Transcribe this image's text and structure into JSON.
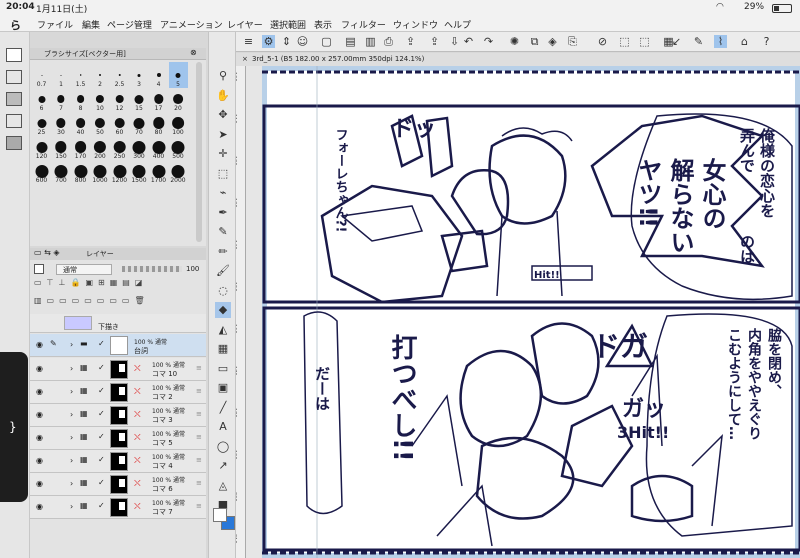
{
  "status": {
    "time": "20:04",
    "date": "1月11日(土)",
    "battery": "29%"
  },
  "menu": [
    "ファイル",
    "編集",
    "ページ管理",
    "アニメーション",
    "レイヤー",
    "選択範囲",
    "表示",
    "フィルター",
    "ウィンドウ",
    "ヘルプ"
  ],
  "brush_panel": {
    "title": "ブラシサイズ[ベクター用]",
    "sizes": [
      "0.7",
      "1",
      "1.5",
      "2",
      "2.5",
      "3",
      "4",
      "5",
      "6",
      "7",
      "8",
      "10",
      "12",
      "15",
      "17",
      "20",
      "25",
      "30",
      "40",
      "50",
      "60",
      "70",
      "80",
      "100",
      "120",
      "150",
      "170",
      "200",
      "250",
      "300",
      "400",
      "500",
      "600",
      "700",
      "800",
      "1000",
      "1200",
      "1500",
      "1700",
      "2000"
    ],
    "selected": "5"
  },
  "layer_panel": {
    "title": "レイヤー",
    "blend_mode": "通常",
    "opacity": "100",
    "top_partial": "下描き",
    "folder": {
      "info": "100 % 通常",
      "name": "台詞"
    },
    "layers": [
      {
        "info": "100 % 通常",
        "name": "コマ 10"
      },
      {
        "info": "100 % 通常",
        "name": "コマ 2"
      },
      {
        "info": "100 % 通常",
        "name": "コマ 3"
      },
      {
        "info": "100 % 通常",
        "name": "コマ 5"
      },
      {
        "info": "100 % 通常",
        "name": "コマ 4"
      },
      {
        "info": "100 % 通常",
        "name": "コマ 6"
      },
      {
        "info": "100 % 通常",
        "name": "コマ 7"
      }
    ]
  },
  "document": {
    "tab": "3rd_5-1 (B5 182.00 x 257.00mm 350dpi 124.1%)"
  },
  "ruler_v": [
    "100",
    "110",
    "120",
    "130",
    "140",
    "150",
    "160",
    "170",
    "180",
    "190",
    "200",
    "210"
  ],
  "manga": {
    "top_right": [
      "俺様の恋心を",
      "弄んで",
      "のは"
    ],
    "top_big": [
      "女心の",
      "解らない",
      "ヤツ!!"
    ],
    "top_left": "フォーレちゃん?!",
    "bot_right": [
      "脇を閉め、",
      "内角をややえぐり",
      "こむようにして…"
    ],
    "bot_big": "打つべし!!",
    "bot_left": "だーは",
    "sfx": [
      "ドッ",
      "ガッ",
      "ドガ",
      "Hit!!",
      "3Hit!!"
    ]
  },
  "colors": {
    "accent": "#1a1a4a",
    "canvas_frame": "#b8d0e8",
    "selection": "#2a78d8"
  }
}
